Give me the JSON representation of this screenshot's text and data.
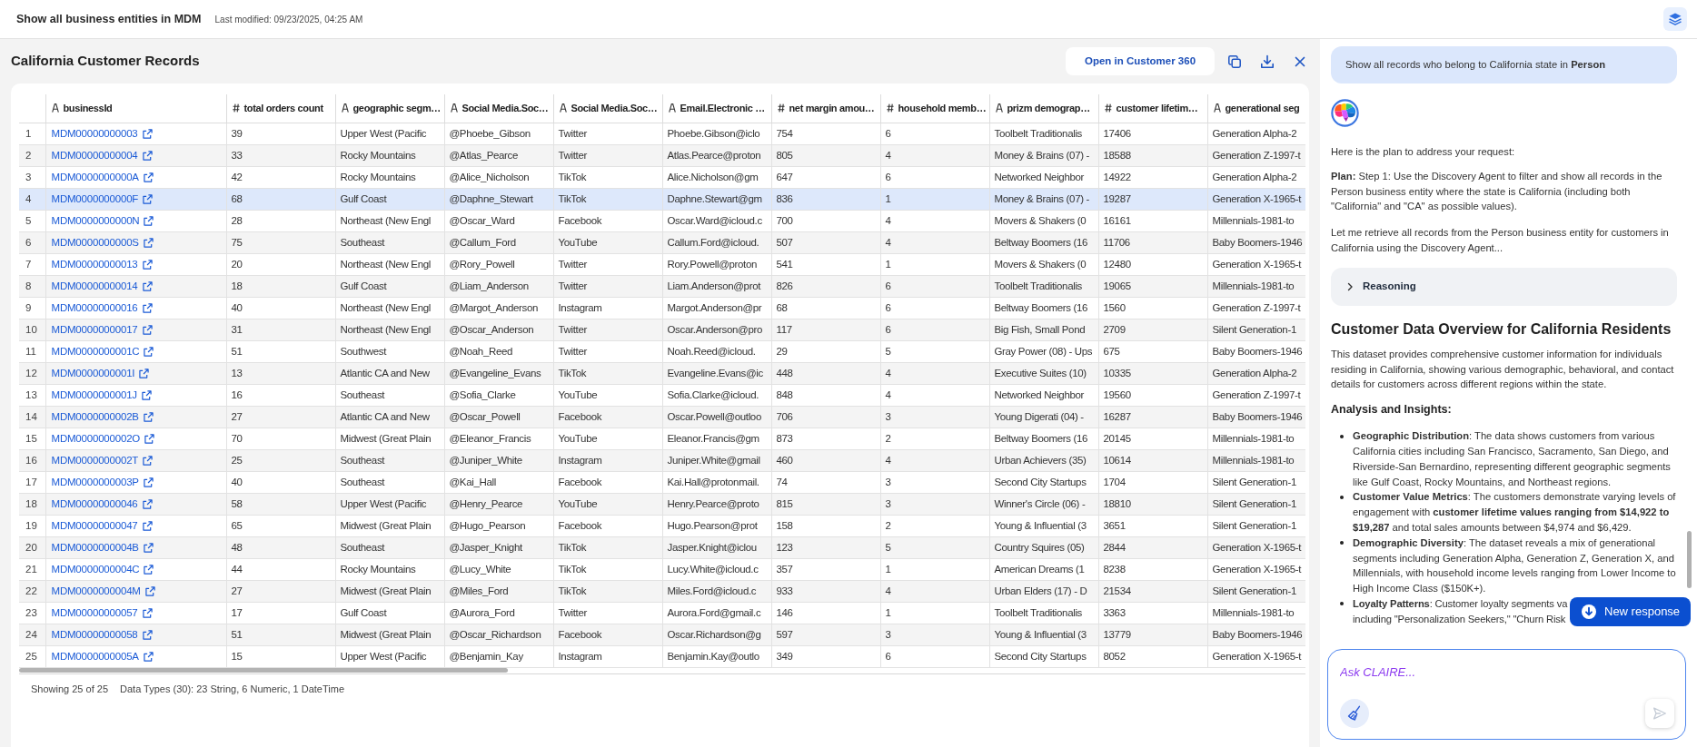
{
  "header": {
    "title": "Show all business entities in MDM",
    "last_modified": "Last modified: 09/23/2025, 04:25 AM"
  },
  "records_panel": {
    "title": "California Customer Records",
    "open_button": "Open in Customer 360",
    "table": {
      "columns": [
        {
          "label": "businessId",
          "kind": "link"
        },
        {
          "label": "total orders count",
          "kind": "number"
        },
        {
          "label": "geographic segm…",
          "kind": "string"
        },
        {
          "label": "Social Media.Soc…",
          "kind": "string"
        },
        {
          "label": "Social Media.Soc…",
          "kind": "string"
        },
        {
          "label": "Email.Electronic …",
          "kind": "string"
        },
        {
          "label": "net margin amou…",
          "kind": "number"
        },
        {
          "label": "household memb…",
          "kind": "number"
        },
        {
          "label": "prizm demograp…",
          "kind": "string"
        },
        {
          "label": "customer lifetim…",
          "kind": "number"
        },
        {
          "label": "generational seg",
          "kind": "string"
        }
      ],
      "rows": [
        {
          "number": "1",
          "selected": false,
          "cells": [
            "MDM00000000003",
            "39",
            "Upper West (Pacific",
            "@Phoebe_Gibson",
            "Twitter",
            "Phoebe.Gibson@iclo",
            "754",
            "6",
            "Toolbelt Traditionalis",
            "17406",
            "Generation Alpha-2"
          ]
        },
        {
          "number": "2",
          "selected": false,
          "cells": [
            "MDM00000000004",
            "33",
            "Rocky Mountains",
            "@Atlas_Pearce",
            "Twitter",
            "Atlas.Pearce@proton",
            "805",
            "4",
            "Money & Brains (07) -",
            "18588",
            "Generation Z-1997-t"
          ]
        },
        {
          "number": "3",
          "selected": false,
          "cells": [
            "MDM0000000000A",
            "42",
            "Rocky Mountains",
            "@Alice_Nicholson",
            "TikTok",
            "Alice.Nicholson@gm",
            "647",
            "6",
            "Networked Neighbor",
            "14922",
            "Generation Alpha-2"
          ]
        },
        {
          "number": "4",
          "selected": true,
          "cells": [
            "MDM0000000000F",
            "68",
            "Gulf Coast",
            "@Daphne_Stewart",
            "TikTok",
            "Daphne.Stewart@gm",
            "836",
            "1",
            "Money & Brains (07) -",
            "19287",
            "Generation X-1965-t"
          ]
        },
        {
          "number": "5",
          "selected": false,
          "cells": [
            "MDM0000000000N",
            "28",
            "Northeast (New Engl",
            "@Oscar_Ward",
            "Facebook",
            "Oscar.Ward@icloud.c",
            "700",
            "4",
            "Movers & Shakers (0",
            "16161",
            "Millennials-1981-to"
          ]
        },
        {
          "number": "6",
          "selected": false,
          "cells": [
            "MDM0000000000S",
            "75",
            "Southeast",
            "@Callum_Ford",
            "YouTube",
            "Callum.Ford@icloud.",
            "507",
            "4",
            "Beltway Boomers (16",
            "11706",
            "Baby Boomers-1946"
          ]
        },
        {
          "number": "7",
          "selected": false,
          "cells": [
            "MDM00000000013",
            "20",
            "Northeast (New Engl",
            "@Rory_Powell",
            "Twitter",
            "Rory.Powell@proton",
            "541",
            "1",
            "Movers & Shakers (0",
            "12480",
            "Generation X-1965-t"
          ]
        },
        {
          "number": "8",
          "selected": false,
          "cells": [
            "MDM00000000014",
            "18",
            "Gulf Coast",
            "@Liam_Anderson",
            "Twitter",
            "Liam.Anderson@prot",
            "826",
            "6",
            "Toolbelt Traditionalis",
            "19065",
            "Millennials-1981-to"
          ]
        },
        {
          "number": "9",
          "selected": false,
          "cells": [
            "MDM00000000016",
            "40",
            "Northeast (New Engl",
            "@Margot_Anderson",
            "Instagram",
            "Margot.Anderson@pr",
            "68",
            "6",
            "Beltway Boomers (16",
            "1560",
            "Generation Z-1997-t"
          ]
        },
        {
          "number": "10",
          "selected": false,
          "cells": [
            "MDM00000000017",
            "31",
            "Northeast (New Engl",
            "@Oscar_Anderson",
            "Twitter",
            "Oscar.Anderson@pro",
            "117",
            "6",
            "Big Fish, Small Pond",
            "2709",
            "Silent Generation-1"
          ]
        },
        {
          "number": "11",
          "selected": false,
          "cells": [
            "MDM0000000001C",
            "51",
            "Southwest",
            "@Noah_Reed",
            "Twitter",
            "Noah.Reed@icloud.",
            "29",
            "5",
            "Gray Power (08) - Ups",
            "675",
            "Baby Boomers-1946"
          ]
        },
        {
          "number": "12",
          "selected": false,
          "cells": [
            "MDM0000000001I",
            "13",
            "Atlantic CA and New",
            "@Evangeline_Evans",
            "TikTok",
            "Evangeline.Evans@ic",
            "448",
            "4",
            "Executive Suites (10)",
            "10335",
            "Generation Alpha-2"
          ]
        },
        {
          "number": "13",
          "selected": false,
          "cells": [
            "MDM0000000001J",
            "16",
            "Southeast",
            "@Sofia_Clarke",
            "YouTube",
            "Sofia.Clarke@icloud.",
            "848",
            "4",
            "Networked Neighbor",
            "19560",
            "Generation Z-1997-t"
          ]
        },
        {
          "number": "14",
          "selected": false,
          "cells": [
            "MDM0000000002B",
            "27",
            "Atlantic CA and New",
            "@Oscar_Powell",
            "Facebook",
            "Oscar.Powell@outloo",
            "706",
            "3",
            "Young Digerati (04) -",
            "16287",
            "Baby Boomers-1946"
          ]
        },
        {
          "number": "15",
          "selected": false,
          "cells": [
            "MDM0000000002O",
            "70",
            "Midwest (Great Plain",
            "@Eleanor_Francis",
            "YouTube",
            "Eleanor.Francis@gm",
            "873",
            "2",
            "Beltway Boomers (16",
            "20145",
            "Millennials-1981-to"
          ]
        },
        {
          "number": "16",
          "selected": false,
          "cells": [
            "MDM0000000002T",
            "25",
            "Southeast",
            "@Juniper_White",
            "Instagram",
            "Juniper.White@gmail",
            "460",
            "4",
            "Urban Achievers (35)",
            "10614",
            "Millennials-1981-to"
          ]
        },
        {
          "number": "17",
          "selected": false,
          "cells": [
            "MDM0000000003P",
            "40",
            "Southeast",
            "@Kai_Hall",
            "Facebook",
            "Kai.Hall@protonmail.",
            "74",
            "3",
            "Second City Startups",
            "1704",
            "Silent Generation-1"
          ]
        },
        {
          "number": "18",
          "selected": false,
          "cells": [
            "MDM00000000046",
            "58",
            "Upper West (Pacific",
            "@Henry_Pearce",
            "YouTube",
            "Henry.Pearce@proto",
            "815",
            "3",
            "Winner's Circle (06) -",
            "18810",
            "Silent Generation-1"
          ]
        },
        {
          "number": "19",
          "selected": false,
          "cells": [
            "MDM00000000047",
            "65",
            "Midwest (Great Plain",
            "@Hugo_Pearson",
            "Facebook",
            "Hugo.Pearson@prot",
            "158",
            "2",
            "Young & Influential (3",
            "3651",
            "Silent Generation-1"
          ]
        },
        {
          "number": "20",
          "selected": false,
          "cells": [
            "MDM0000000004B",
            "48",
            "Southeast",
            "@Jasper_Knight",
            "TikTok",
            "Jasper.Knight@iclou",
            "123",
            "5",
            "Country Squires (05)",
            "2844",
            "Generation X-1965-t"
          ]
        },
        {
          "number": "21",
          "selected": false,
          "cells": [
            "MDM0000000004C",
            "44",
            "Rocky Mountains",
            "@Lucy_White",
            "TikTok",
            "Lucy.White@icloud.c",
            "357",
            "1",
            "American Dreams (1",
            "8238",
            "Generation X-1965-t"
          ]
        },
        {
          "number": "22",
          "selected": false,
          "cells": [
            "MDM0000000004M",
            "27",
            "Midwest (Great Plain",
            "@Miles_Ford",
            "TikTok",
            "Miles.Ford@icloud.c",
            "933",
            "4",
            "Urban Elders (17) - D",
            "21534",
            "Silent Generation-1"
          ]
        },
        {
          "number": "23",
          "selected": false,
          "cells": [
            "MDM00000000057",
            "17",
            "Gulf Coast",
            "@Aurora_Ford",
            "Twitter",
            "Aurora.Ford@gmail.c",
            "146",
            "1",
            "Toolbelt Traditionalis",
            "3363",
            "Millennials-1981-to"
          ]
        },
        {
          "number": "24",
          "selected": false,
          "cells": [
            "MDM00000000058",
            "51",
            "Midwest (Great Plain",
            "@Oscar_Richardson",
            "Facebook",
            "Oscar.Richardson@g",
            "597",
            "3",
            "Young & Influential (3",
            "13779",
            "Baby Boomers-1946"
          ]
        },
        {
          "number": "25",
          "selected": false,
          "cells": [
            "MDM0000000005A",
            "15",
            "Upper West (Pacific",
            "@Benjamin_Kay",
            "Instagram",
            "Benjamin.Kay@outlo",
            "349",
            "6",
            "Second City Startups",
            "8052",
            "Generation X-1965-t"
          ]
        }
      ]
    },
    "footer": {
      "showing": "Showing 25 of 25",
      "data_types": "Data Types (30): 23 String, 6 Numeric, 1 DateTime"
    }
  },
  "chat": {
    "user_message": "Show all records who belong to California state in **Person**",
    "intro": "Here is the plan to address your request:",
    "plan": "**Plan:** Step 1: Use the Discovery Agent to filter and show all records in the Person business entity where the state is California (including both \"California\" and \"CA\" as possible values).",
    "status": "Let me retrieve all records from the Person business entity for customers in California using the Discovery Agent...",
    "reasoning": {
      "label": "Reasoning",
      "expanded": false
    },
    "heading": "Customer Data Overview for California Residents",
    "description": "This dataset provides comprehensive customer information for individuals residing in California, showing various demographic, behavioral, and contact details for customers across different regions within the state.",
    "subheading": "Analysis and Insights:",
    "bullets": [
      "**Geographic Distribution**: The data shows customers from various California cities including San Francisco, Sacramento, San Diego, and Riverside-San Bernardino, representing different geographic segments like Gulf Coast, Rocky Mountains, and Northeast regions.",
      "**Customer Value Metrics**: The customers demonstrate varying levels of engagement with **customer lifetime values ranging from $14,922 to $19,287** and total sales amounts between $4,974 and $6,429.",
      "**Demographic Diversity**: The dataset reveals a mix of generational segments including Generation Alpha, Generation Z, Generation X, and Millennials, with household income levels ranging from Lower Income to High Income Class ($150K+).",
      "**Loyalty Patterns**: Customer loyalty segments va including \"Personalization Seekers,\" \"Churn Risk"
    ],
    "new_response_button": "New response",
    "composer": {
      "placeholder": "Ask CLAIRE...",
      "send_disabled": true
    }
  }
}
